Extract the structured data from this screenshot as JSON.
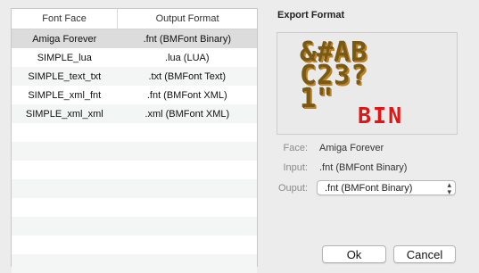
{
  "table": {
    "headers": [
      "Font Face",
      "Output Format"
    ],
    "rows": [
      {
        "face": "Amiga Forever",
        "format": ".fnt (BMFont Binary)",
        "selected": true
      },
      {
        "face": "SIMPLE_lua",
        "format": ".lua (LUA)"
      },
      {
        "face": "SIMPLE_text_txt",
        "format": ".txt (BMFont Text)"
      },
      {
        "face": "SIMPLE_xml_fnt",
        "format": ".fnt (BMFont XML)"
      },
      {
        "face": "SIMPLE_xml_xml",
        "format": ".xml (BMFont XML)"
      }
    ]
  },
  "export": {
    "title": "Export Format",
    "preview_lines": [
      "&#AB",
      "C23?",
      "1\""
    ],
    "preview_badge": "BIN",
    "face_label": "Face:",
    "face_value": "Amiga Forever",
    "input_label": "Input:",
    "input_value": ".fnt (BMFont Binary)",
    "output_label": "Ouput:",
    "output_value": ".fnt (BMFont Binary)"
  },
  "buttons": {
    "ok": "Ok",
    "cancel": "Cancel"
  },
  "colors": {
    "preview_glyph": "#7a5a12",
    "preview_badge": "#e01515",
    "selected_row": "#dcdcdc"
  }
}
